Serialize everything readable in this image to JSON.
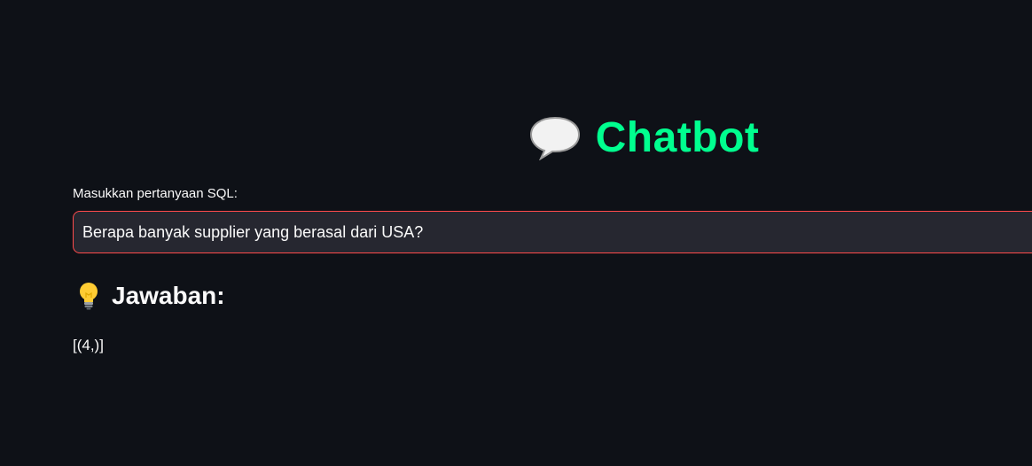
{
  "header": {
    "icon": "speech-bubble-icon",
    "title": "Chatbot",
    "title_color": "#00ff8f"
  },
  "query": {
    "label": "Masukkan pertanyaan SQL:",
    "value": "Berapa banyak supplier yang berasal dari USA?",
    "border_color": "#ff4b4b"
  },
  "answer": {
    "icon": "lightbulb-icon",
    "heading": "Jawaban:",
    "result": "[(4,)]"
  },
  "theme": {
    "background": "#0e1117",
    "input_background": "#262730",
    "text": "#fafafa"
  }
}
